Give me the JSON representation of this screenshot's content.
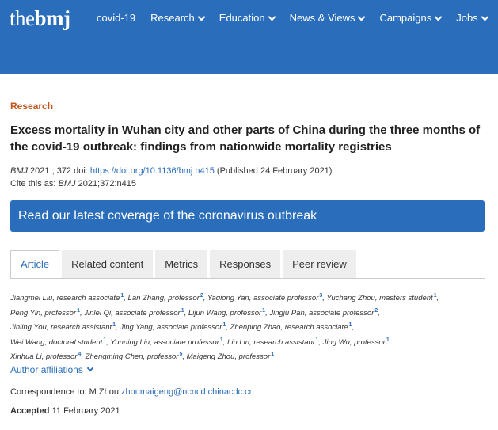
{
  "header": {
    "logo_the": "the",
    "logo_bmj": "bmj",
    "nav": [
      {
        "label": "covid-19",
        "has_dropdown": false
      },
      {
        "label": "Research",
        "has_dropdown": true
      },
      {
        "label": "Education",
        "has_dropdown": true
      },
      {
        "label": "News & Views",
        "has_dropdown": true
      },
      {
        "label": "Campaigns",
        "has_dropdown": true
      },
      {
        "label": "Jobs",
        "has_dropdown": true
      }
    ],
    "bg_color": "#2a6ebb"
  },
  "article": {
    "section": "Research",
    "title": "Excess mortality in Wuhan city and other parts of China during the three months of the covid-19 outbreak: findings from nationwide mortality registries",
    "citation": {
      "journal": "BMJ",
      "year_vol": " 2021 ; 372  doi: ",
      "doi_link": "https://doi.org/10.1136/bmj.n415",
      "published": " (Published 24 February 2021)",
      "cite_prefix": "Cite this as: ",
      "cite_journal": "BMJ",
      "cite_ref": " 2021;372:n415"
    },
    "banner": "Read our latest coverage of the coronavirus outbreak",
    "tabs": [
      {
        "label": "Article",
        "active": true
      },
      {
        "label": "Related content",
        "active": false
      },
      {
        "label": "Metrics",
        "active": false
      },
      {
        "label": "Responses",
        "active": false
      },
      {
        "label": "Peer review",
        "active": false
      }
    ],
    "authors": [
      {
        "name": "Jiangmei Liu, research associate",
        "aff": "1"
      },
      {
        "name": "Lan Zhang, professor",
        "aff": "2"
      },
      {
        "name": "Yaqiong Yan, associate professor",
        "aff": "3"
      },
      {
        "name": "Yuchang Zhou, masters student",
        "aff": "1"
      },
      {
        "name": "Peng Yin, professor",
        "aff": "1"
      },
      {
        "name": "Jinlei Qi, associate professor",
        "aff": "1"
      },
      {
        "name": "Lijun Wang, professor",
        "aff": "1"
      },
      {
        "name": "Jingju Pan, associate professor",
        "aff": "2"
      },
      {
        "name": "Jinling You, research assistant",
        "aff": "1"
      },
      {
        "name": "Jing Yang, associate professor",
        "aff": "1"
      },
      {
        "name": "Zhenping Zhao, research associate",
        "aff": "1"
      },
      {
        "name": "Wei Wang, doctoral student",
        "aff": "1"
      },
      {
        "name": "Yunning Liu, associate professor",
        "aff": "1"
      },
      {
        "name": "Lin Lin, research assistant",
        "aff": "1"
      },
      {
        "name": "Jing Wu, professor",
        "aff": "1"
      },
      {
        "name": "Xinhua Li, professor",
        "aff": "4"
      },
      {
        "name": "Zhengming Chen, professor",
        "aff": "5"
      },
      {
        "name": "Maigeng Zhou, professor",
        "aff": "1"
      }
    ],
    "affiliations_label": "Author affiliations",
    "correspondence_prefix": "Correspondence to: M Zhou ",
    "correspondence_email": "zhoumaigeng@ncncd.chinacdc.cn",
    "accepted_label": "Accepted",
    "accepted_date": " 11 February 2021"
  }
}
